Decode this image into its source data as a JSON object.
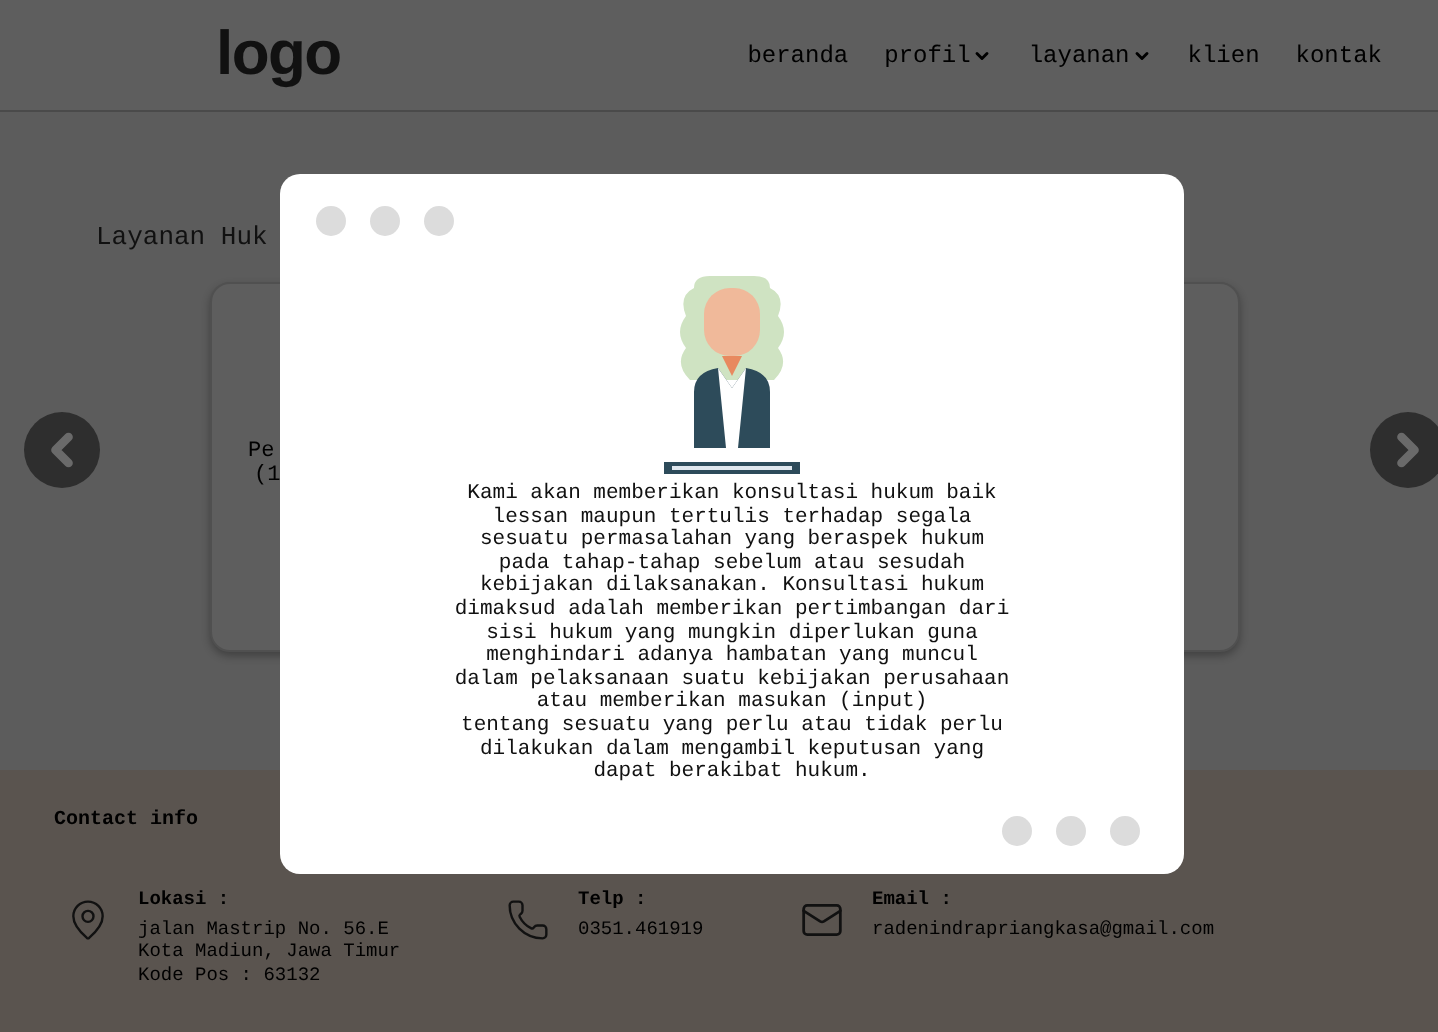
{
  "header": {
    "logo": "logo",
    "nav": [
      {
        "label": "beranda",
        "dropdown": false
      },
      {
        "label": "profil",
        "dropdown": true
      },
      {
        "label": "layanan",
        "dropdown": true
      },
      {
        "label": "klien",
        "dropdown": false
      },
      {
        "label": "kontak",
        "dropdown": false
      }
    ]
  },
  "section": {
    "title": "Layanan Huk",
    "card_lines": [
      "Pe",
      "(1"
    ]
  },
  "modal": {
    "body_lines": [
      "Kami akan memberikan konsultasi hukum baik",
      "lessan maupun tertulis terhadap segala",
      "sesuatu permasalahan yang beraspek hukum",
      "pada tahap-tahap sebelum atau sesudah",
      "kebijakan dilaksanakan. Konsultasi hukum",
      "dimaksud adalah memberikan pertimbangan dari",
      "sisi hukum yang mungkin diperlukan guna",
      "menghindari adanya hambatan yang muncul",
      "dalam pelaksanaan suatu kebijakan perusahaan",
      "atau memberikan masukan (input)",
      "tentang sesuatu yang perlu atau tidak perlu",
      "dilakukan dalam mengambil keputusan yang",
      "dapat berakibat hukum."
    ]
  },
  "footer": {
    "title": "Contact info",
    "contacts": [
      {
        "kind": "location",
        "label": "Lokasi :",
        "lines": [
          "jalan Mastrip No. 56.E",
          "Kota Madiun, Jawa Timur",
          "Kode Pos : 63132"
        ]
      },
      {
        "kind": "phone",
        "label": "Telp :",
        "lines": [
          "0351.461919"
        ]
      },
      {
        "kind": "email",
        "label": "Email :",
        "lines": [
          "radenindrapriangkasa@gmail.com"
        ]
      }
    ]
  }
}
